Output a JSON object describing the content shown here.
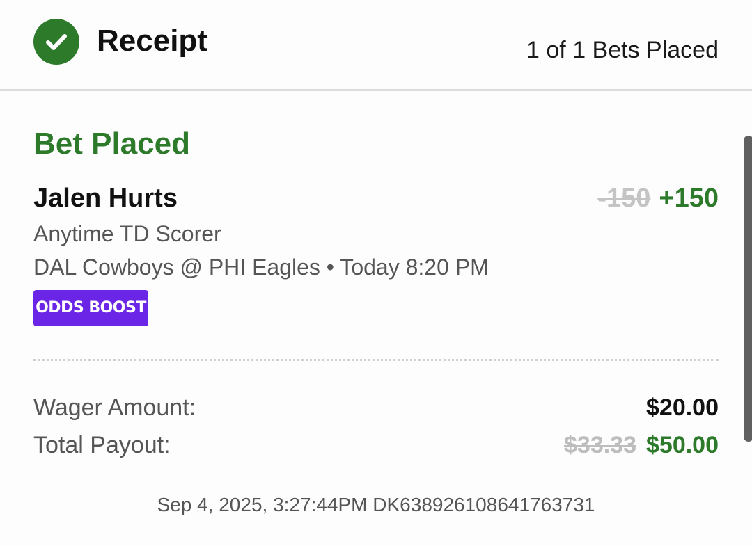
{
  "header": {
    "title": "Receipt",
    "bets_count": "1 of 1 Bets Placed",
    "icon": "check-circle-icon"
  },
  "bet": {
    "status": "Bet Placed",
    "player": "Jalen Hurts",
    "odds_original": "-150",
    "odds_boosted": "+150",
    "market": "Anytime TD Scorer",
    "event": "DAL Cowboys @ PHI Eagles • Today 8:20 PM",
    "badge": "ODDS BOOST"
  },
  "summary": {
    "wager_label": "Wager Amount:",
    "wager_value": "$20.00",
    "payout_label": "Total Payout:",
    "payout_original": "$33.33",
    "payout_boosted": "$50.00"
  },
  "footer": {
    "meta": "Sep 4, 2025, 3:27:44PM DK638926108641763731"
  },
  "colors": {
    "success_green": "#2d7a2a",
    "boost_purple": "#6a25e6",
    "muted_gray": "#c4c4c4"
  }
}
